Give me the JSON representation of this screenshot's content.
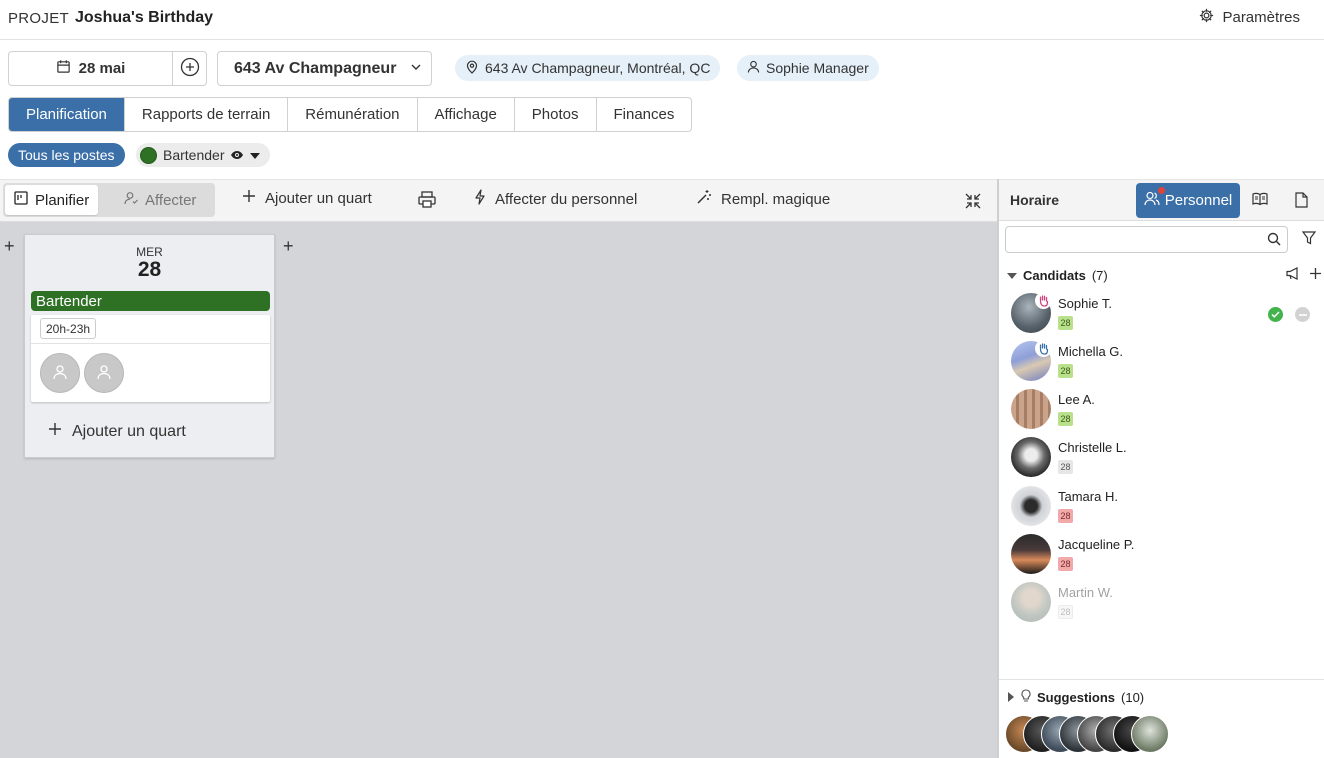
{
  "header": {
    "project_label": "PROJET",
    "project_title": "Joshua's Birthday",
    "settings_label": "Paramètres"
  },
  "event": {
    "date": "28 mai",
    "location_select": "643 Av Champagneur",
    "address": "643 Av Champagneur, Montréal, QC",
    "manager": "Sophie Manager"
  },
  "tabs": [
    {
      "label": "Planification",
      "active": true
    },
    {
      "label": "Rapports de terrain"
    },
    {
      "label": "Rémunération"
    },
    {
      "label": "Affichage"
    },
    {
      "label": "Photos"
    },
    {
      "label": "Finances"
    }
  ],
  "filters": {
    "all_label": "Tous les postes",
    "role_label": "Bartender",
    "role_color": "#2e7024"
  },
  "toolbar": {
    "plan_label": "Planifier",
    "assign_label": "Affecter",
    "add_shift_label": "Ajouter un quart",
    "assign_staff_label": "Affecter du personnel",
    "magic_fill_label": "Rempl. magique"
  },
  "day": {
    "weekday": "MER",
    "day_number": "28",
    "role": "Bartender",
    "shift_time": "20h-23h",
    "open_slots": 2,
    "add_shift_label": "Ajouter un quart"
  },
  "panel": {
    "title": "Horaire",
    "personnel_label": "Personnel",
    "search_placeholder": "",
    "candidates_label": "Candidats",
    "candidates_count": "(7)",
    "suggestions_label": "Suggestions",
    "suggestions_count": "(10)",
    "candidates": [
      {
        "name": "Sophie T.",
        "tag": "28",
        "tag_status": "available",
        "hand": "pink"
      },
      {
        "name": "Michella G.",
        "tag": "28",
        "tag_status": "available",
        "hand": "blue"
      },
      {
        "name": "Lee A.",
        "tag": "28",
        "tag_status": "available"
      },
      {
        "name": "Christelle L.",
        "tag": "28",
        "tag_status": "neutral"
      },
      {
        "name": "Tamara H.",
        "tag": "28",
        "tag_status": "unavailable"
      },
      {
        "name": "Jacqueline P.",
        "tag": "28",
        "tag_status": "unavailable"
      },
      {
        "name": "Martin W.",
        "tag": "28",
        "tag_status": "inactive"
      }
    ]
  },
  "colors": {
    "accent": "#3a6fa8",
    "role_green": "#2e7024",
    "tag_green": "#b9e08b",
    "tag_red": "#f2a9a9",
    "tag_gray": "#e6e6e6"
  }
}
